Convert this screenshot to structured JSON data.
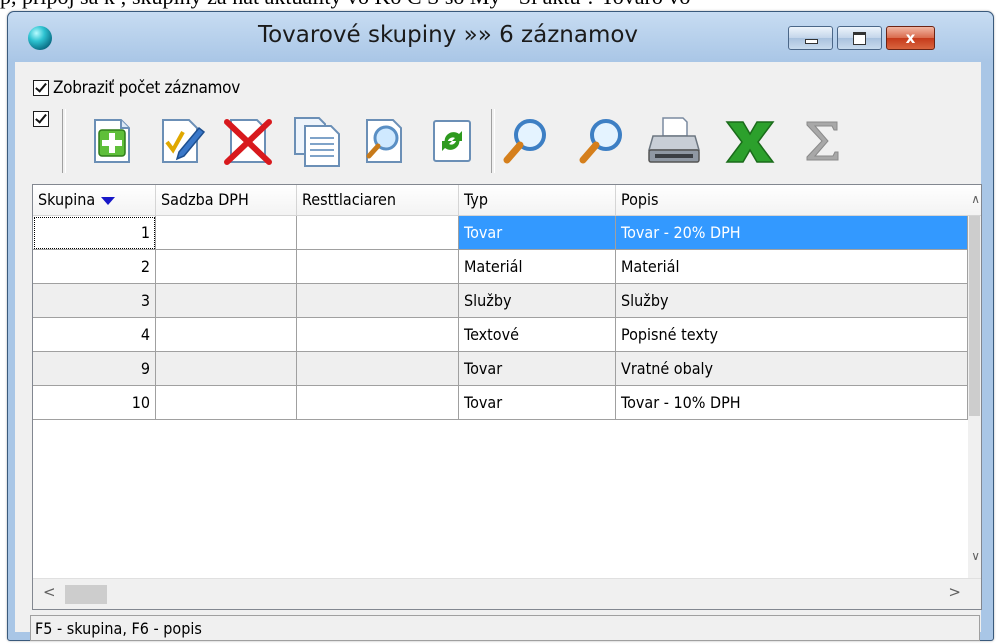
{
  "background_caption": "p, pripoj sa k ; skupiny za nat aktuality vo Ko C S so My - Si aktu ? Tovaro vo",
  "window": {
    "title": "Tovarové skupiny »» 6 záznamov",
    "close_glyph": "x"
  },
  "options": {
    "show_count_label": "Zobraziť počet záznamov",
    "show_count_checked": true,
    "second_checked": true
  },
  "toolbar": {
    "icons": [
      "add-icon",
      "edit-icon",
      "delete-icon",
      "copy-icon",
      "preview-icon",
      "refresh-icon",
      "search-icon",
      "search-next-icon",
      "print-icon",
      "excel-icon",
      "sum-icon"
    ]
  },
  "grid": {
    "columns": [
      "Skupina",
      "Sadzba DPH",
      "Resttlaciaren",
      "Typ",
      "Popis"
    ],
    "sort_column": "Skupina",
    "rows": [
      {
        "skupina": "1",
        "sadzba": "",
        "resttlaciaren": "",
        "typ": "Tovar",
        "popis": "Tovar - 20% DPH"
      },
      {
        "skupina": "2",
        "sadzba": "",
        "resttlaciaren": "",
        "typ": "Materiál",
        "popis": "Materiál"
      },
      {
        "skupina": "3",
        "sadzba": "",
        "resttlaciaren": "",
        "typ": "Služby",
        "popis": "Služby"
      },
      {
        "skupina": "4",
        "sadzba": "",
        "resttlaciaren": "",
        "typ": "Textové",
        "popis": "Popisné texty"
      },
      {
        "skupina": "9",
        "sadzba": "",
        "resttlaciaren": "",
        "typ": "Tovar",
        "popis": "Vratné obaly"
      },
      {
        "skupina": "10",
        "sadzba": "",
        "resttlaciaren": "",
        "typ": "Tovar",
        "popis": "Tovar - 10% DPH"
      }
    ],
    "selected_row": 0
  },
  "status": {
    "text": "F5 - skupina, F6 - popis"
  },
  "colors": {
    "selection": "#3399ff",
    "sort_arrow": "#1717c8",
    "title_bar": "#a9c6e6"
  }
}
